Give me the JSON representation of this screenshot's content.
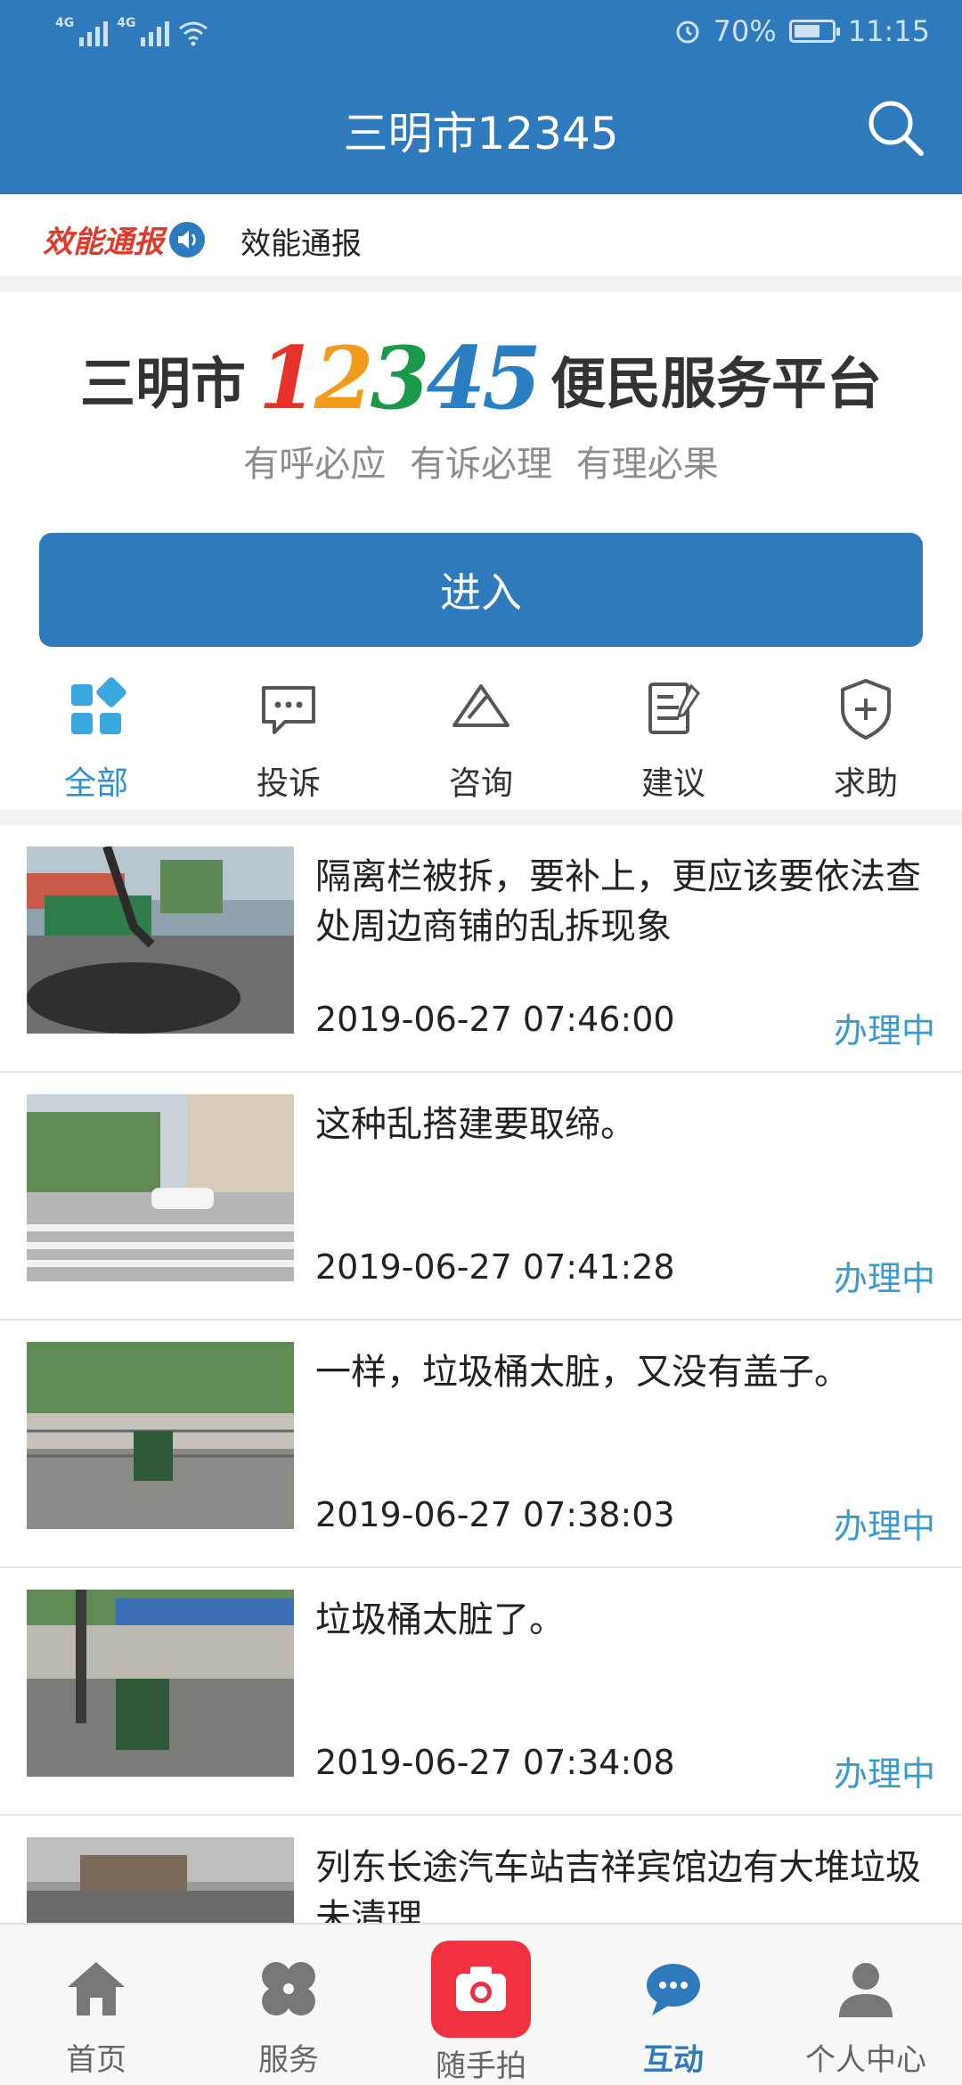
{
  "status_bar": {
    "network_1": "4G",
    "network_2": "4G",
    "battery": "70%",
    "time": "11:15"
  },
  "header": {
    "title": "三明市12345",
    "search_icon": "search-icon"
  },
  "notice": {
    "logo_text": "效能通报",
    "text": "效能通报"
  },
  "banner": {
    "brand_prefix": "三明市",
    "brand_digits": [
      "1",
      "2",
      "3",
      "4",
      "5"
    ],
    "digit_colors": [
      "#e5332a",
      "#f29b1d",
      "#1a9a49",
      "#2a7fc2",
      "#2a7fc2"
    ],
    "brand_suffix": "便民服务平台",
    "slogan": "有呼必应 有诉必理 有理必果",
    "enter_label": "进入"
  },
  "categories": [
    {
      "label": "全部",
      "icon": "grid-icon",
      "active": true
    },
    {
      "label": "投诉",
      "icon": "chat-bubble-icon",
      "active": false
    },
    {
      "label": "咨询",
      "icon": "envelope-pen-icon",
      "active": false
    },
    {
      "label": "建议",
      "icon": "document-pen-icon",
      "active": false
    },
    {
      "label": "求助",
      "icon": "shield-plus-icon",
      "active": false
    }
  ],
  "items": [
    {
      "title": "隔离栏被拆，要补上，更应该要依法查处周边商铺的乱拆现象",
      "time": "2019-06-27 07:46:00",
      "status": "办理中"
    },
    {
      "title": "这种乱搭建要取缔。",
      "time": "2019-06-27 07:41:28",
      "status": "办理中"
    },
    {
      "title": "一样，垃圾桶太脏，又没有盖子。",
      "time": "2019-06-27 07:38:03",
      "status": "办理中"
    },
    {
      "title": "垃圾桶太脏了。",
      "time": "2019-06-27 07:34:08",
      "status": "办理中"
    },
    {
      "title": "列东长途汽车站吉祥宾馆边有大堆垃圾未清理",
      "time": "",
      "status": ""
    }
  ],
  "tabs": [
    {
      "label": "首页",
      "icon": "home-icon",
      "active": false
    },
    {
      "label": "服务",
      "icon": "four-petal-icon",
      "active": false
    },
    {
      "label": "随手拍",
      "icon": "camera-icon",
      "active": false
    },
    {
      "label": "互动",
      "icon": "chat-icon",
      "active": true
    },
    {
      "label": "个人中心",
      "icon": "person-icon",
      "active": false
    }
  ],
  "colors": {
    "primary": "#2f79bd",
    "status": "#3a9ad0",
    "camera": "#ef3140"
  }
}
